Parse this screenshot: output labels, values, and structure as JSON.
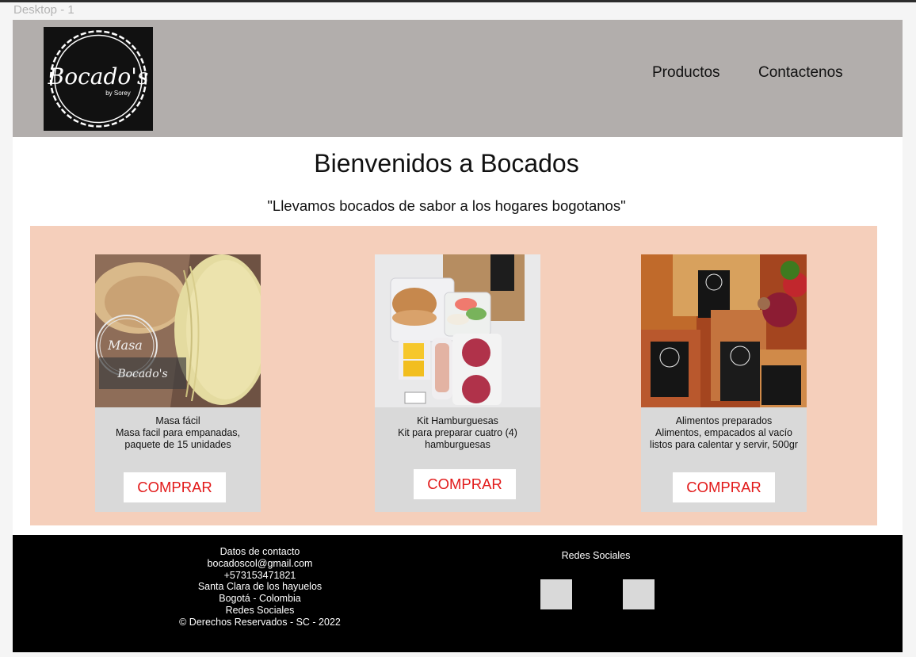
{
  "frame_label": "Desktop - 1",
  "header": {
    "logo": {
      "brand": "Bocado's",
      "sub": "by Sorey",
      "icon": "bocados-logo"
    },
    "nav": [
      "Productos",
      "Contactenos"
    ]
  },
  "welcome": {
    "title": "Bienvenidos a Bocados",
    "tagline": "\"Llevamos bocados de sabor a los hogares bogotanos\""
  },
  "products": [
    {
      "name": "Masa fácil",
      "desc": "Masa facil para empanadas, paquete de 15 unidades",
      "button": "COMPRAR",
      "image": "empanada-dough-photo"
    },
    {
      "name": "Kit Hamburguesas",
      "desc": "Kit para preparar cuatro (4) hamburguesas",
      "button": "COMPRAR",
      "image": "burger-kit-photo"
    },
    {
      "name": "Alimentos preparados",
      "desc": "Alimentos, empacados al vacío listos para calentar y servir, 500gr",
      "button": "COMPRAR",
      "image": "packaged-food-photo"
    }
  ],
  "footer": {
    "contact_lines": [
      "Datos de contacto",
      "bocadoscol@gmail.com",
      "+573153471821",
      "Santa Clara de los hayuelos",
      "Bogotá - Colombia",
      "Redes Sociales",
      "© Derechos Reservados - SC - 2022"
    ],
    "social_title": "Redes Sociales",
    "social_icons": [
      "social-icon-1",
      "social-icon-2"
    ]
  },
  "colors": {
    "header_bg": "#b2aeac",
    "products_bg": "#f5cfbb",
    "card_bg": "#d9d9d9",
    "button_text": "#e21a1a",
    "footer_bg": "#000000"
  }
}
